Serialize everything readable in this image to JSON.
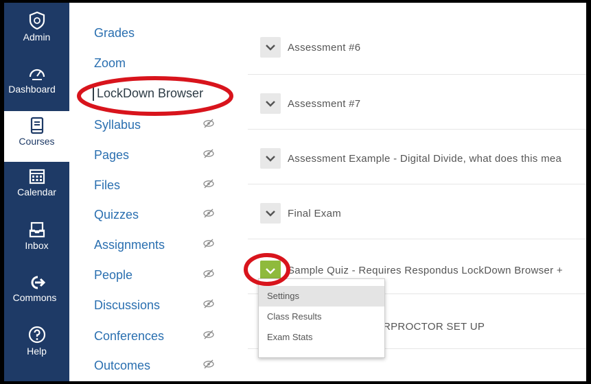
{
  "global_nav": [
    {
      "label": "Admin",
      "icon": "shield-icon"
    },
    {
      "label": "Dashboard",
      "icon": "dashboard-icon"
    },
    {
      "label": "Courses",
      "icon": "book-icon",
      "active": true
    },
    {
      "label": "Calendar",
      "icon": "calendar-icon"
    },
    {
      "label": "Inbox",
      "icon": "inbox-icon"
    },
    {
      "label": "Commons",
      "icon": "arrow-right-icon"
    },
    {
      "label": "Help",
      "icon": "help-icon"
    }
  ],
  "course_nav": [
    {
      "label": "Grades",
      "hidden": false
    },
    {
      "label": "Zoom",
      "hidden": false
    },
    {
      "label": "LockDown Browser",
      "hidden": false,
      "active": true
    },
    {
      "label": "Syllabus",
      "hidden": true
    },
    {
      "label": "Pages",
      "hidden": true
    },
    {
      "label": "Files",
      "hidden": true
    },
    {
      "label": "Quizzes",
      "hidden": true
    },
    {
      "label": "Assignments",
      "hidden": true
    },
    {
      "label": "People",
      "hidden": true
    },
    {
      "label": "Discussions",
      "hidden": true
    },
    {
      "label": "Conferences",
      "hidden": true
    },
    {
      "label": "Outcomes",
      "hidden": true
    }
  ],
  "quiz_rows": [
    {
      "title": "Assessment #6"
    },
    {
      "title": "Assessment #7"
    },
    {
      "title": "Assessment Example - Digital Divide, what does this mea"
    },
    {
      "title": "Final Exam"
    },
    {
      "title": "Sample Quiz - Requires Respondus LockDown Browser +"
    },
    {
      "title": "RPROCTOR SET UP"
    }
  ],
  "quiz_menu": [
    "Settings",
    "Class Results",
    "Exam Stats"
  ],
  "colors": {
    "nav_bg": "#1e3a66",
    "link": "#2a6fb0",
    "highlight_red": "#d8141c",
    "active_toggle": "#8fba3c"
  }
}
